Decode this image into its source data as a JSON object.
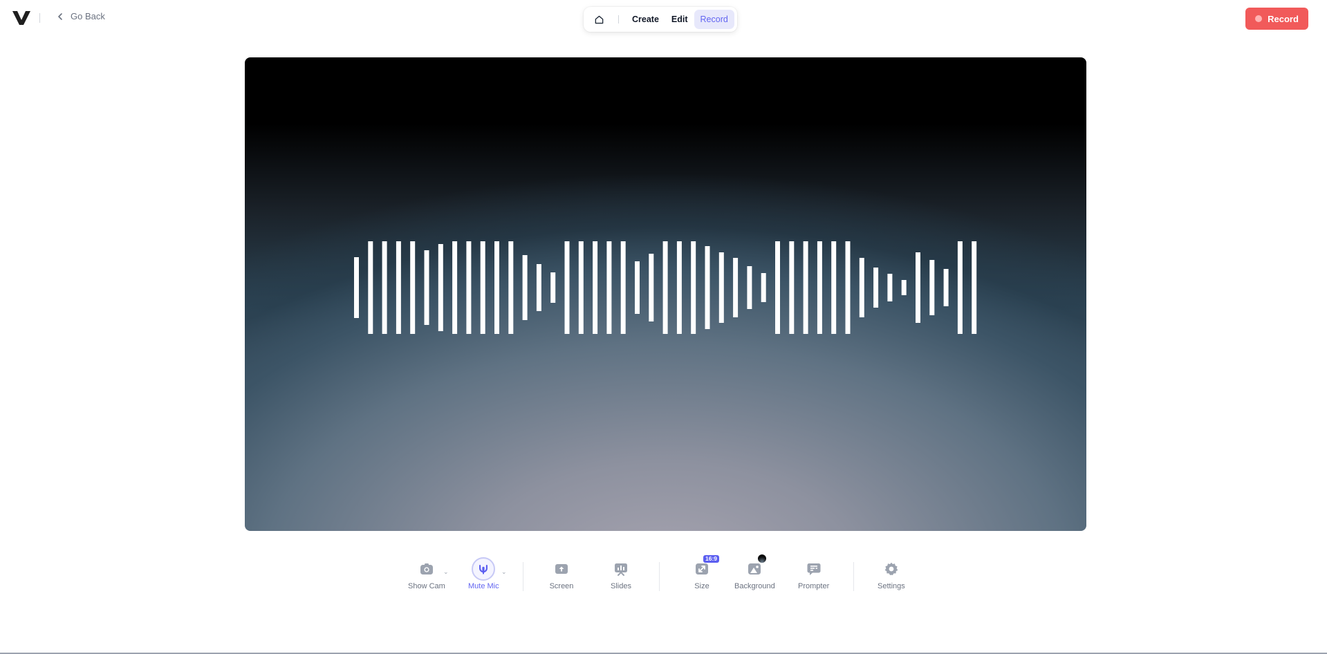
{
  "header": {
    "go_back_label": "Go Back",
    "tabs": [
      {
        "label": "Create",
        "active": false
      },
      {
        "label": "Edit",
        "active": false
      },
      {
        "label": "Record",
        "active": true
      }
    ],
    "record_button_label": "Record"
  },
  "stage": {
    "visualizer": "audio-waveform"
  },
  "toolbar": {
    "items": [
      {
        "label": "Show Cam",
        "icon": "camera-icon"
      },
      {
        "label": "Mute Mic",
        "icon": "microphone-icon",
        "active": true
      },
      {
        "label": "Screen",
        "icon": "screen-share-icon"
      },
      {
        "label": "Slides",
        "icon": "slides-icon"
      },
      {
        "label": "Size",
        "icon": "resize-icon",
        "badge": "16:9"
      },
      {
        "label": "Background",
        "icon": "image-icon"
      },
      {
        "label": "Prompter",
        "icon": "prompter-icon"
      },
      {
        "label": "Settings",
        "icon": "gear-icon"
      }
    ]
  },
  "colors": {
    "accent": "#6366f1",
    "record": "#f15a5a",
    "icon_gray": "#9ca3af"
  }
}
